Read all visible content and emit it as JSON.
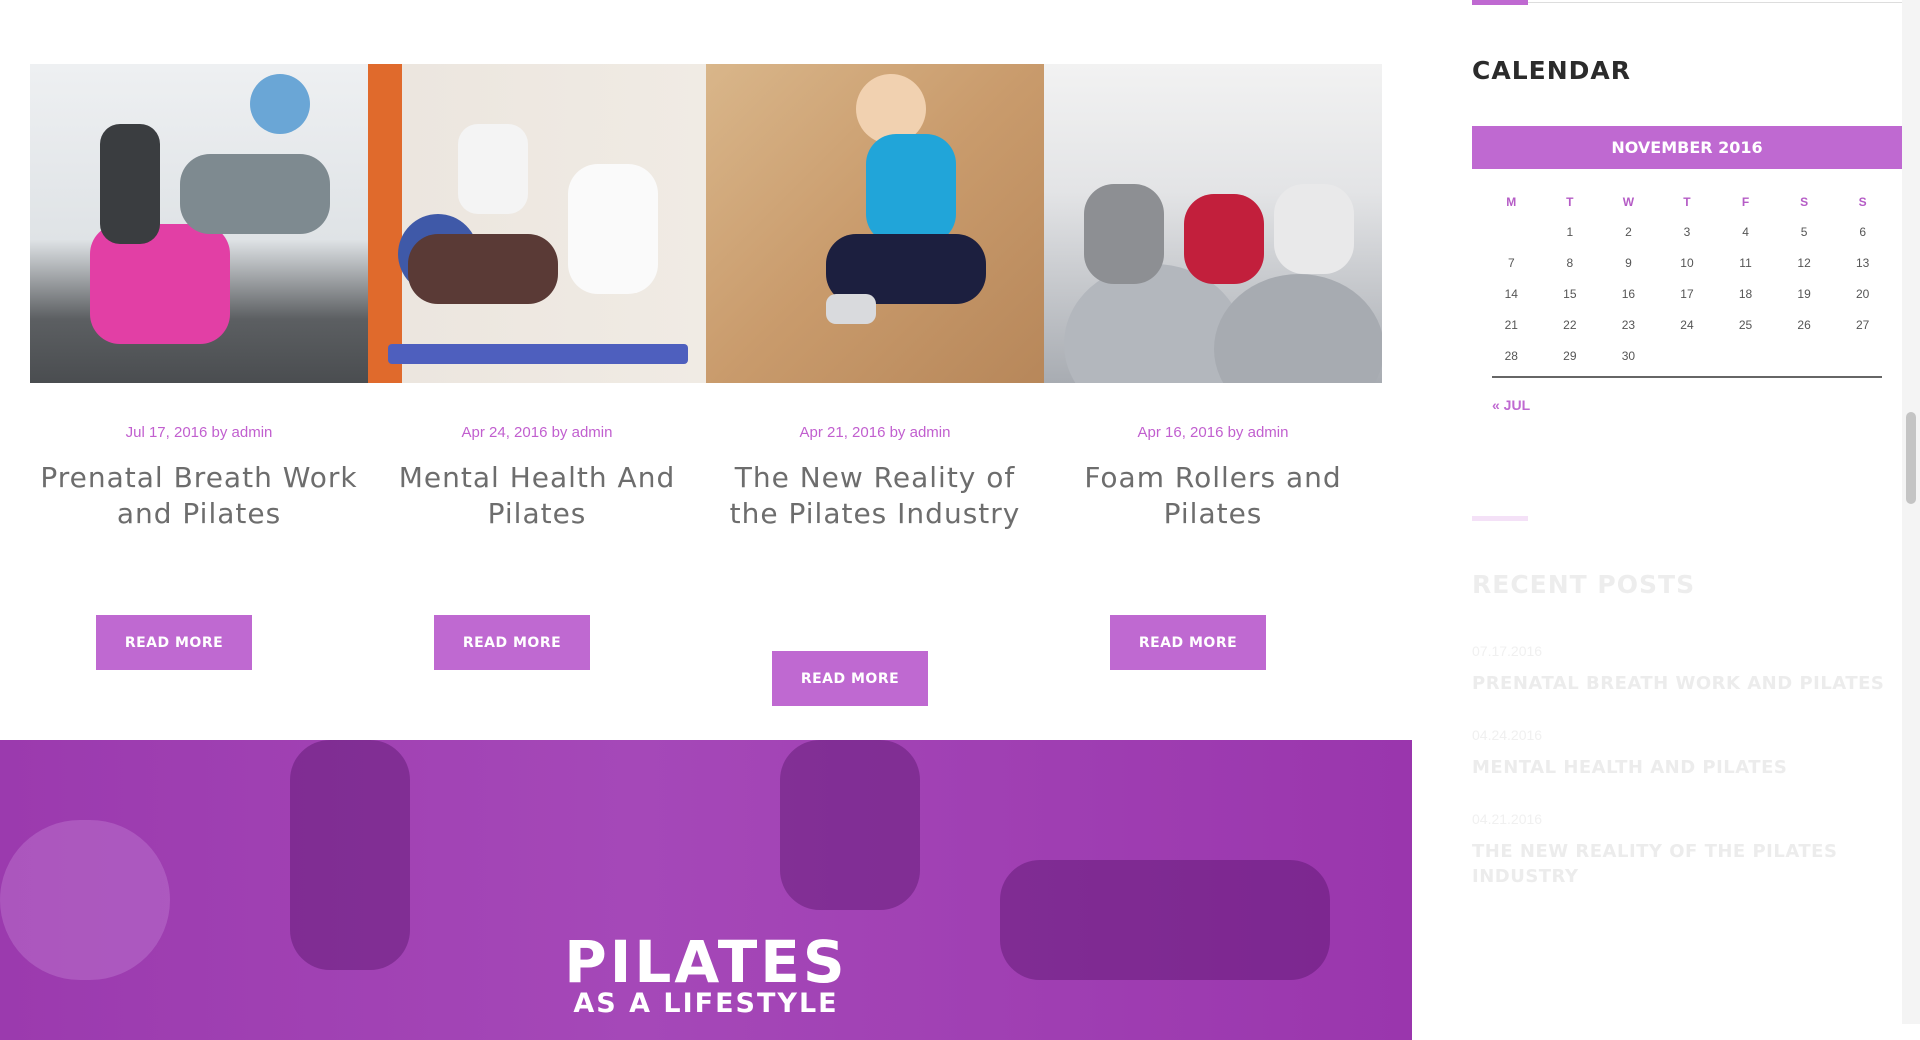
{
  "posts": [
    {
      "date": "Jul 17, 2016",
      "by": "by",
      "author": "admin",
      "title": "Prenatal Breath Work and Pilates",
      "button": "READ MORE",
      "image": "pilates-class-photo"
    },
    {
      "date": "Apr 24, 2016",
      "by": "by",
      "author": "admin",
      "title": "Mental Health And Pilates",
      "button": "READ MORE",
      "image": "yoga-stretch-photo"
    },
    {
      "date": "Apr 21, 2016",
      "by": "by",
      "author": "admin",
      "title": "The New Reality of the Pilates Industry",
      "button": "READ MORE",
      "image": "woman-stretching-photo"
    },
    {
      "date": "Apr 16, 2016",
      "by": "by",
      "author": "admin",
      "title": "Foam Rollers and Pilates",
      "button": "READ MORE",
      "image": "exercise-ball-group-photo"
    }
  ],
  "banner": {
    "line1": "PILATES",
    "line2": "AS A LIFESTYLE"
  },
  "calendar": {
    "title": "CALENDAR",
    "month": "NOVEMBER 2016",
    "weekdays": [
      "M",
      "T",
      "W",
      "T",
      "F",
      "S",
      "S"
    ],
    "weeks": [
      [
        "",
        "1",
        "2",
        "3",
        "4",
        "5",
        "6"
      ],
      [
        "7",
        "8",
        "9",
        "10",
        "11",
        "12",
        "13"
      ],
      [
        "14",
        "15",
        "16",
        "17",
        "18",
        "19",
        "20"
      ],
      [
        "21",
        "22",
        "23",
        "24",
        "25",
        "26",
        "27"
      ],
      [
        "28",
        "29",
        "30",
        "",
        "",
        "",
        ""
      ]
    ],
    "prev_link": "« JUL"
  },
  "recent_posts": {
    "title": "RECENT POSTS",
    "items": [
      {
        "date": "07.17.2016",
        "title": "PRENATAL BREATH WORK AND PILATES"
      },
      {
        "date": "04.24.2016",
        "title": "MENTAL HEALTH AND PILATES"
      },
      {
        "date": "04.21.2016",
        "title": "THE NEW REALITY OF THE PILATES INDUSTRY"
      }
    ]
  },
  "colors": {
    "accent": "#bf69d1",
    "banner": "#a548b8",
    "title_text": "#6d6d6d",
    "calendar_title": "#2b2b2b"
  }
}
